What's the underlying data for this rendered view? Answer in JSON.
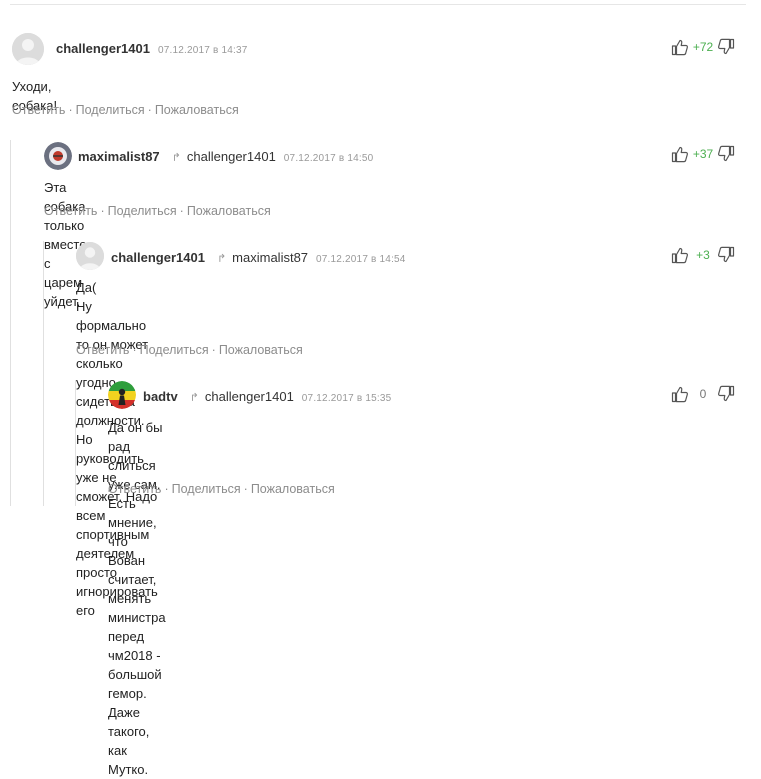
{
  "comments": [
    {
      "author": "challenger1401",
      "reply_to": "",
      "date": "07.12.2017 в 14:37",
      "text_lines": [
        "Уходи, собака!"
      ],
      "score": "+72",
      "actions": [
        "Ответить",
        "Поделиться",
        "Пожаловаться"
      ],
      "avatar_icon": "default-avatar-icon"
    },
    {
      "author": "maximalist87",
      "reply_to": "challenger1401",
      "date": "07.12.2017 в 14:50",
      "text_lines": [
        "Эта собака только вместе с царем уйдет."
      ],
      "score": "+37",
      "actions": [
        "Ответить",
        "Поделиться",
        "Пожаловаться"
      ],
      "avatar_icon": "custom-avatar-icon"
    },
    {
      "author": "challenger1401",
      "reply_to": "maximalist87",
      "date": "07.12.2017 в 14:54",
      "text_lines": [
        "Да(",
        "Ну формально то он может сколько угодно сидеть на должности. Но руководить уже не сможет. Надо",
        "всем спортивным деятелем просто игнорировать его"
      ],
      "score": "+3",
      "actions": [
        "Ответить",
        "Поделиться",
        "Пожаловаться"
      ],
      "avatar_icon": "default-avatar-icon"
    },
    {
      "author": "badtv",
      "reply_to": "challenger1401",
      "date": "07.12.2017 в 15:35",
      "text_lines": [
        "Да он бы рад слиться уже сам.",
        "Есть мнение, что Вован считает, менять министра перед чм2018 - большой гемор. Даже такого, как",
        "Мутко."
      ],
      "score": "0",
      "actions": [
        "Ответить",
        "Поделиться",
        "Пожаловаться"
      ],
      "avatar_icon": "rasta-avatar-icon"
    }
  ],
  "colors": {
    "positive_score": "#4caf50",
    "muted_text": "#8c8c8c",
    "thread_line": "#e0e0e0"
  }
}
